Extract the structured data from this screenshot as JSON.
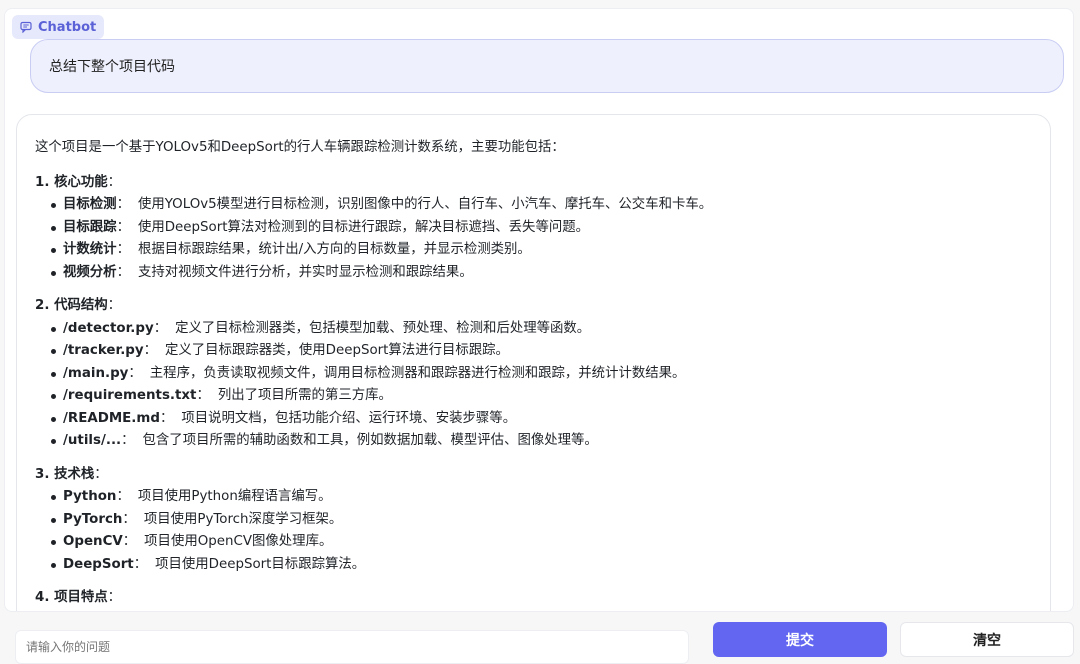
{
  "chatbot_label": "Chatbot",
  "user_message": "总结下整个项目代码",
  "bot_message": {
    "intro": "这个项目是一个基于YOLOv5和DeepSort的行人车辆跟踪检测计数系统，主要功能包括：",
    "sections": [
      {
        "title": "1. 核心功能",
        "items": [
          {
            "key": "目标检测",
            "text": "使用YOLOv5模型进行目标检测，识别图像中的行人、自行车、小汽车、摩托车、公交车和卡车。"
          },
          {
            "key": "目标跟踪",
            "text": "使用DeepSort算法对检测到的目标进行跟踪，解决目标遮挡、丢失等问题。"
          },
          {
            "key": "计数统计",
            "text": "根据目标跟踪结果，统计出/入方向的目标数量，并显示检测类别。"
          },
          {
            "key": "视频分析",
            "text": "支持对视频文件进行分析，并实时显示检测和跟踪结果。"
          }
        ]
      },
      {
        "title": "2. 代码结构",
        "items": [
          {
            "key": "/detector.py",
            "text": "定义了目标检测器类，包括模型加载、预处理、检测和后处理等函数。"
          },
          {
            "key": "/tracker.py",
            "text": "定义了目标跟踪器类，使用DeepSort算法进行目标跟踪。"
          },
          {
            "key": "/main.py",
            "text": "主程序，负责读取视频文件，调用目标检测器和跟踪器进行检测和跟踪，并统计计数结果。"
          },
          {
            "key": "/requirements.txt",
            "text": "列出了项目所需的第三方库。"
          },
          {
            "key": "/README.md",
            "text": "项目说明文档，包括功能介绍、运行环境、安装步骤等。"
          },
          {
            "key": "/utils/...",
            "text": "包含了项目所需的辅助函数和工具，例如数据加载、模型评估、图像处理等。"
          }
        ]
      },
      {
        "title": "3. 技术栈",
        "items": [
          {
            "key": "Python",
            "text": "项目使用Python编程语言编写。"
          },
          {
            "key": "PyTorch",
            "text": "项目使用PyTorch深度学习框架。"
          },
          {
            "key": "OpenCV",
            "text": "项目使用OpenCV图像处理库。"
          },
          {
            "key": "DeepSort",
            "text": "项目使用DeepSort目标跟踪算法。"
          }
        ]
      },
      {
        "title": "4. 项目特点",
        "items": []
      }
    ]
  },
  "input": {
    "placeholder": "请输入你的问题",
    "value": ""
  },
  "submit_label": "提交",
  "clear_label": "清空",
  "colors": {
    "accent": "#6366f1",
    "user_bubble": "#eef0fd",
    "tag_bg": "#e6e9fb"
  }
}
